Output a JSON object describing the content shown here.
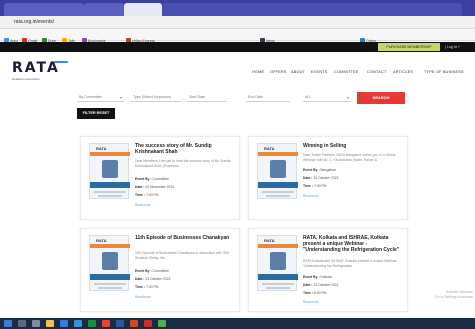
{
  "browser": {
    "url": "rata.org.in/events/"
  },
  "bookmarks": [
    {
      "label": "Apps",
      "color": "#4c8bf5"
    },
    {
      "label": "Gmail",
      "color": "#d93025"
    },
    {
      "label": "Drive",
      "color": "#1e8e3e"
    },
    {
      "label": "Tally",
      "color": "#f9ab00"
    },
    {
      "label": "Bookmarks",
      "color": "#8e44ad"
    },
    {
      "label": "Indian Express",
      "color": "#c0392b"
    },
    {
      "label": "News",
      "color": "#2c3e50"
    },
    {
      "label": "Online",
      "color": "#2980b9"
    }
  ],
  "topbar": {
    "purchase_label": "PURCHASE MEMBERSHIP",
    "login_label": "| Log In +"
  },
  "logo": {
    "text": "RATA",
    "tagline": "Retailers Association"
  },
  "nav": [
    "HOME",
    "OFFERS",
    "ABOUT",
    "EVENTS",
    "COMMITTEE",
    "CONTACT",
    "ARTICLES",
    "TYPE OF BUSINESS"
  ],
  "filters": {
    "committee": "By Committee",
    "type": "Type (Select Keywords)",
    "start": "Start Date",
    "end": "End Date",
    "all": "ALL",
    "search_label": "SEARCH",
    "reset_label": "FILTER RESET"
  },
  "cards": [
    {
      "title": "The success story of Mr. Sundip Krishnakant Shah",
      "desc": "Dear Members, Lets get to hear the success story of Mr. Sundip Krishnakant Shah (Proprietor,",
      "event_by": "Committee",
      "date": "02 November 2021",
      "time": "7:00 PM",
      "read_more": "Read more"
    },
    {
      "title": "Winning in Selling",
      "desc": "Dear Textile Partners, RATA Bangalore invites you to a Online Webinar with Mr. C. Kirubakaran (Sales Trainer &",
      "event_by": "Bangalore",
      "date": "20 October 2021",
      "time": "7:00 PM",
      "read_more": "Read more"
    },
    {
      "title": "11th Episode of Businesses Chanakyan",
      "desc": "11th Episode of Businesses Chanakyan in discussion with Shri. Shailesh Shetty, the",
      "event_by": "Committee",
      "date": "23 October 2021",
      "time": "7:00 PM",
      "read_more": "Read more"
    },
    {
      "title": "RATA, Kolkata and ISHRAE, Kolkata present a unique Webinar - \"Understanding the Refrigeration Cycle\"",
      "desc": "RATA Kolkata and ISHRAE, Kolkata present a unique Webinar - \"Understanding the Refrigeration",
      "event_by": "Kolkata",
      "date": "24 October 2021",
      "time": "6:00 PM",
      "read_more": "Read more"
    }
  ],
  "labels": {
    "event_by": "Event By : ",
    "date": "Date : ",
    "time": "Time : ",
    "thumb_brand": "RATA"
  },
  "watermark": {
    "line1": "Activate Windows",
    "line2": "Go to Settings to activate"
  }
}
